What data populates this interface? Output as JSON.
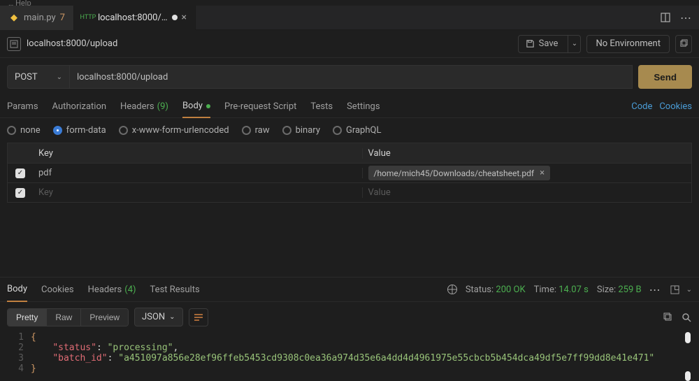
{
  "menu_fragment": "…  Help",
  "tabs": [
    {
      "icon_color": "#f0c040",
      "label": "main.py",
      "count": "7",
      "dirty": false
    },
    {
      "icon_color": "#4caf50",
      "label": "localhost:8000/…",
      "dirty": true
    }
  ],
  "document_title": "localhost:8000/upload",
  "save_label": "Save",
  "environment_label": "No Environment",
  "request": {
    "method": "POST",
    "url": "localhost:8000/upload",
    "send_label": "Send"
  },
  "req_tabs": {
    "params": "Params",
    "authorization": "Authorization",
    "headers": "Headers",
    "headers_count": "(9)",
    "body": "Body",
    "prerequest": "Pre-request Script",
    "tests": "Tests",
    "settings": "Settings",
    "code_link": "Code",
    "cookies_link": "Cookies"
  },
  "body_types": {
    "none": "none",
    "form_data": "form-data",
    "x_www": "x-www-form-urlencoded",
    "raw": "raw",
    "binary": "binary",
    "graphql": "GraphQL"
  },
  "kv": {
    "key_header": "Key",
    "value_header": "Value",
    "row1_key": "pdf",
    "row1_file_chip": "/home/mich45/Downloads/cheatsheet.pdf",
    "row2_key_placeholder": "Key",
    "row2_value_placeholder": "Value"
  },
  "resp_tabs": {
    "body": "Body",
    "cookies": "Cookies",
    "headers": "Headers",
    "headers_count": "(4)",
    "test_results": "Test Results"
  },
  "status_line": {
    "status_label": "Status:",
    "status_value": "200 OK",
    "time_label": "Time:",
    "time_value": "14.07 s",
    "size_label": "Size:",
    "size_value": "259 B"
  },
  "view_modes": {
    "pretty": "Pretty",
    "raw": "Raw",
    "preview": "Preview"
  },
  "format_label": "JSON",
  "response_json": {
    "line1_num": "1",
    "line2_num": "2",
    "line3_num": "3",
    "line4_num": "4",
    "brace_open": "{",
    "brace_close": "}",
    "status_key": "\"status\"",
    "status_val": "\"processing\"",
    "batch_key": "\"batch_id\"",
    "batch_val": "\"a451097a856e28ef96ffeb5453cd9308c0ea36a974d35e6a4dd4d4961975e55cbcb5b454dca49df5e7ff99dd8e41e471\"",
    "comma": ","
  }
}
